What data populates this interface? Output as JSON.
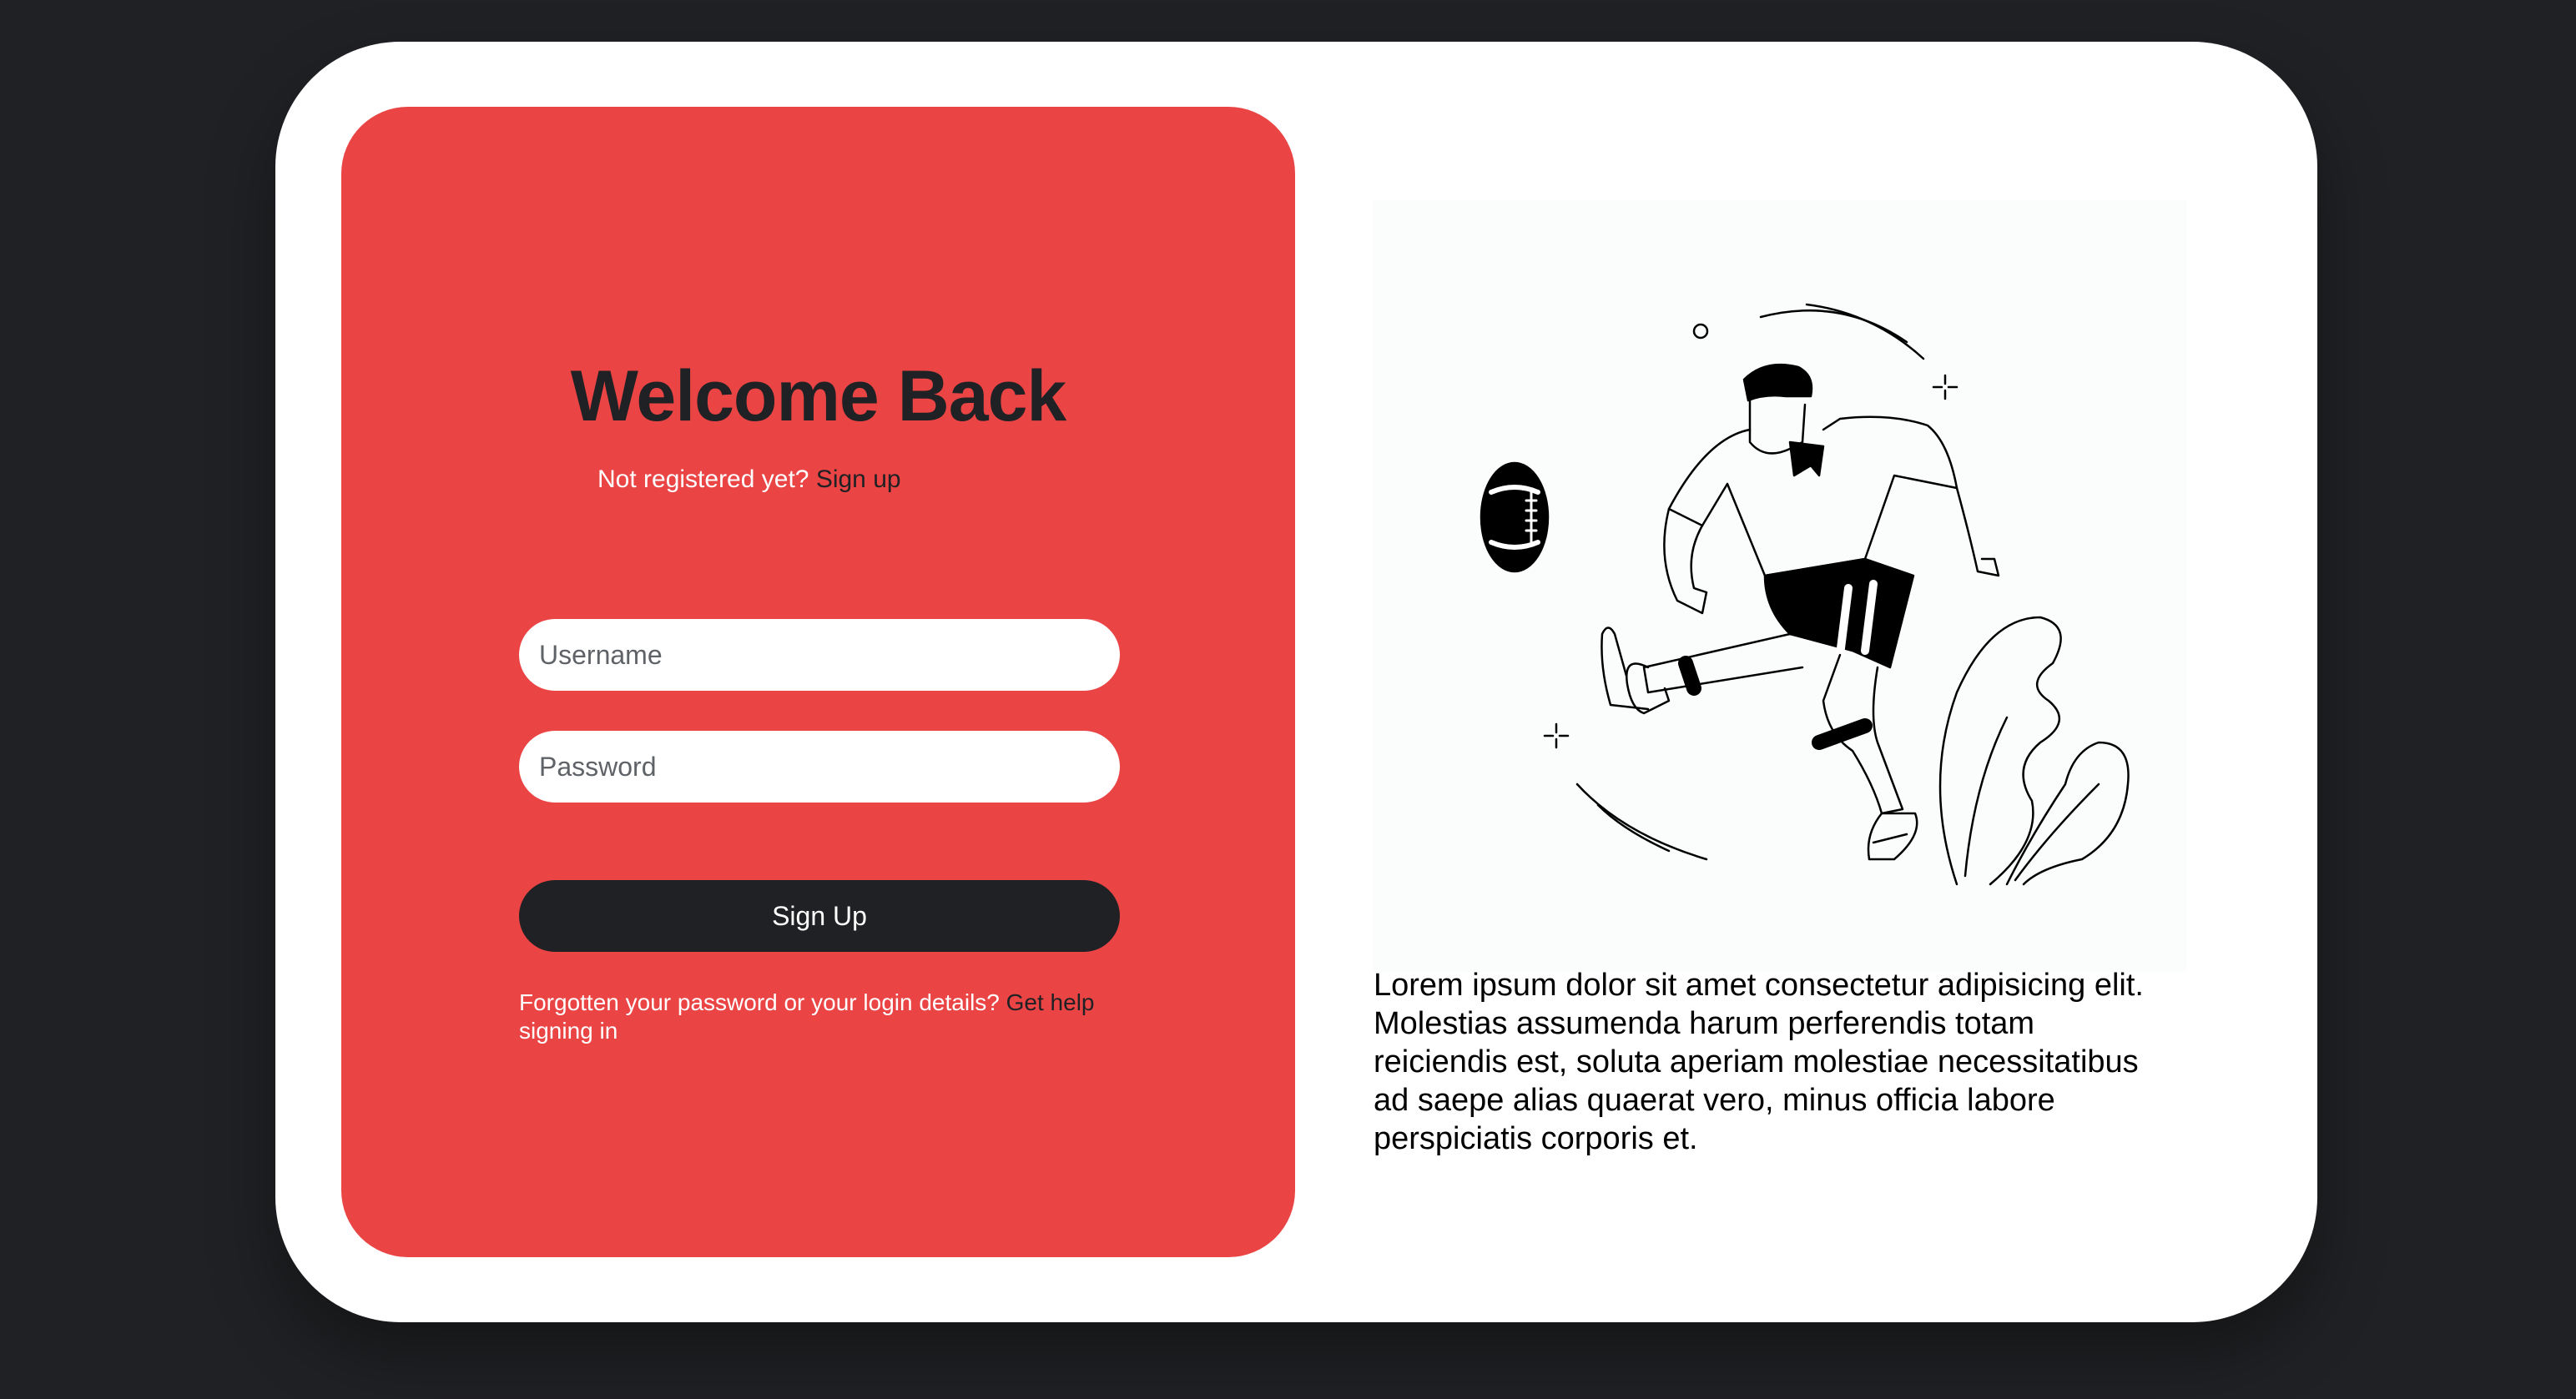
{
  "login": {
    "title": "Welcome Back",
    "not_registered_text": "Not registered yet?",
    "sign_up_link": "Sign up",
    "username_placeholder": "Username",
    "password_placeholder": "Password",
    "submit_label": "Sign Up",
    "help_text": "Forgotten your password or your login details?",
    "help_link_part1": "Get help",
    "help_link_part2": "signing in"
  },
  "aside": {
    "illustration": "football-player-kicking-ball-illustration",
    "description": "Lorem ipsum dolor sit amet consectetur adipisicing elit. Molestias assumenda harum perferendis totam reiciendis est, soluta aperiam molestiae necessitatibus ad saepe alias quaerat vero, minus officia labore perspiciatis corporis et."
  },
  "colors": {
    "background": "#202124",
    "card": "#ffffff",
    "accent": "#ea4444",
    "dark": "#202124"
  }
}
